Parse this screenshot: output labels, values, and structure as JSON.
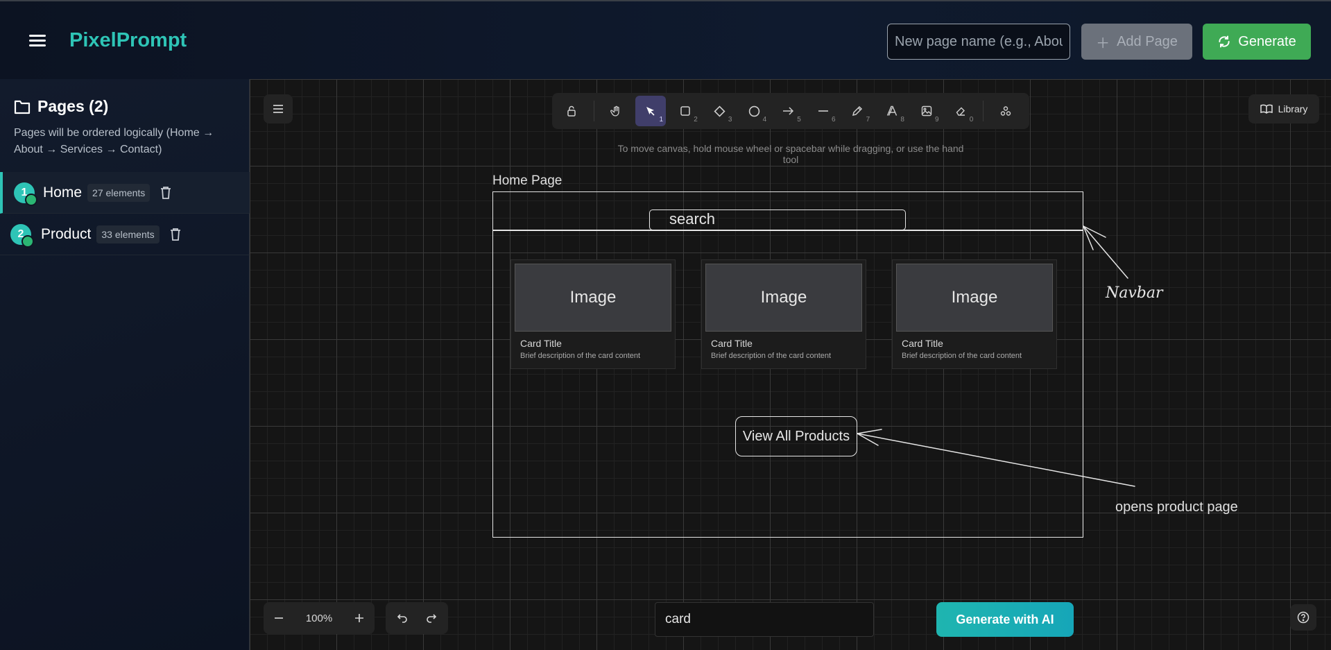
{
  "app": {
    "brand": "PixelPrompt"
  },
  "header": {
    "page_name_placeholder": "New page name (e.g., About)",
    "add_page_label": "Add Page",
    "generate_label": "Generate"
  },
  "sidebar": {
    "title": "Pages (2)",
    "description": "Pages will be ordered logically (Home → About → Services → Contact)",
    "pages": [
      {
        "number": "1",
        "name": "Home",
        "count": "27 elements",
        "active": true
      },
      {
        "number": "2",
        "name": "Product",
        "count": "33 elements",
        "active": false
      }
    ]
  },
  "canvas": {
    "library_label": "Library",
    "hint": "To move canvas, hold mouse wheel or spacebar while dragging, or use the hand tool",
    "tools": [
      {
        "icon": "lock-icon",
        "key": ""
      },
      {
        "icon": "hand-icon",
        "key": ""
      },
      {
        "icon": "selection-arrow-icon",
        "key": "1",
        "selected": true
      },
      {
        "icon": "rectangle-icon",
        "key": "2"
      },
      {
        "icon": "diamond-icon",
        "key": "3"
      },
      {
        "icon": "ellipse-icon",
        "key": "4"
      },
      {
        "icon": "arrow-icon",
        "key": "5"
      },
      {
        "icon": "line-icon",
        "key": "6"
      },
      {
        "icon": "pencil-icon",
        "key": "7"
      },
      {
        "icon": "text-icon",
        "key": "8"
      },
      {
        "icon": "image-icon",
        "key": "9"
      },
      {
        "icon": "eraser-icon",
        "key": "0"
      },
      {
        "icon": "shapes-icon",
        "key": ""
      }
    ],
    "wireframe": {
      "frame_label": "Home Page",
      "search_text": "search",
      "cards": [
        {
          "image": "Image",
          "title": "Card Title",
          "desc": "Brief description of the card content"
        },
        {
          "image": "Image",
          "title": "Card Title",
          "desc": "Brief description of the card content"
        },
        {
          "image": "Image",
          "title": "Card Title",
          "desc": "Brief description of the card content"
        }
      ],
      "button": "View All Products",
      "annotation_navbar": "Navbar",
      "annotation_note": "opens product page"
    },
    "zoom": "100%",
    "prompt_value": "card",
    "ai_button": "Generate with AI"
  },
  "colors": {
    "accent": "#2ec4b6",
    "generate": "#3faa55",
    "selected_tool": "#403e6a"
  }
}
